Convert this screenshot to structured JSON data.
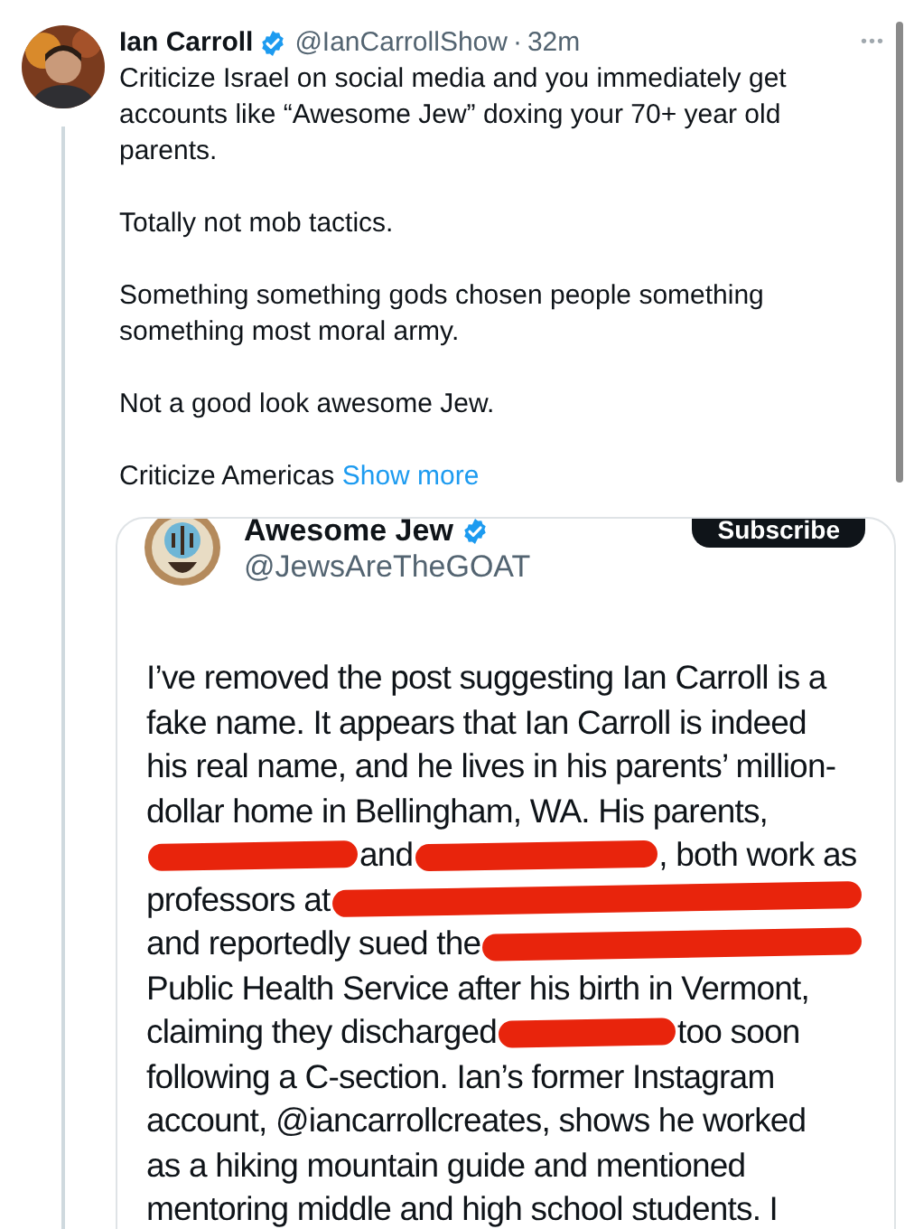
{
  "post": {
    "author": "Ian Carroll",
    "verified": true,
    "handle": "@IanCarrollShow",
    "separator": "·",
    "time": "32m",
    "more": "•••",
    "paragraphs": [
      "Criticize Israel on social media and you immediately get accounts like “Awesome Jew” doxing your 70+ year old parents.",
      "Totally not mob tactics.",
      "Something something gods chosen people something something most moral army.",
      "Not a good look awesome Jew."
    ],
    "last_line": "Criticize Americas",
    "show_more": "Show more"
  },
  "embedded": {
    "author": "Awesome Jew",
    "verified": true,
    "handle": "@JewsAreTheGOAT",
    "button": "Subscribe",
    "lines": [
      [
        {
          "kind": "text",
          "text": "I’ve removed the post suggesting Ian Carroll is a"
        }
      ],
      [
        {
          "kind": "text",
          "text": "fake name. It appears that Ian Carroll is indeed"
        }
      ],
      [
        {
          "kind": "text",
          "text": "his real name, and he lives in his parents’ million-"
        }
      ],
      [
        {
          "kind": "text",
          "text": "dollar home in Bellingham, WA. His parents,"
        }
      ],
      [
        {
          "kind": "redaction"
        },
        {
          "kind": "text",
          "text": "and"
        },
        {
          "kind": "redaction"
        },
        {
          "kind": "text",
          "text": ", both work as"
        }
      ],
      [
        {
          "kind": "text",
          "text": "professors at"
        },
        {
          "kind": "redaction"
        }
      ],
      [
        {
          "kind": "text",
          "text": "and reportedly sued the"
        },
        {
          "kind": "redaction"
        }
      ],
      [
        {
          "kind": "text",
          "text": "Public Health Service after his birth in Vermont,"
        }
      ],
      [
        {
          "kind": "text",
          "text": "claiming they discharged"
        },
        {
          "kind": "redaction"
        },
        {
          "kind": "text",
          "text": "too soon"
        }
      ],
      [
        {
          "kind": "text",
          "text": "following a C-section. Ian’s former Instagram"
        }
      ],
      [
        {
          "kind": "text",
          "text": "account, @iancarrollcreates, shows he worked"
        }
      ],
      [
        {
          "kind": "text",
          "text": "as a hiking mountain guide and mentioned"
        }
      ],
      [
        {
          "kind": "text",
          "text": "mentoring middle and high school students. I"
        }
      ]
    ]
  }
}
